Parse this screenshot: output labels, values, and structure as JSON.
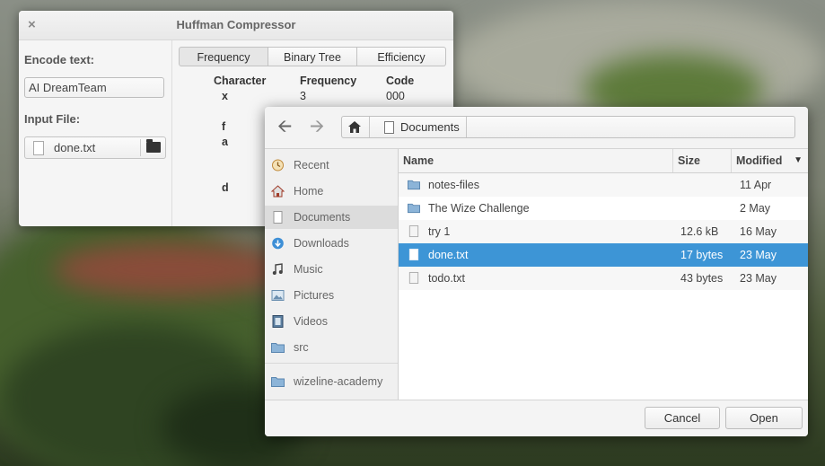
{
  "app": {
    "title": "Huffman Compressor",
    "close_glyph": "×",
    "encode_label": "Encode text:",
    "encode_value": "AI DreamTeam",
    "input_file_label": "Input File:",
    "input_file_name": "done.txt",
    "tabs": [
      "Frequency",
      "Binary Tree",
      "Efficiency"
    ],
    "table": {
      "headers": [
        "Character",
        "Frequency",
        "Code"
      ],
      "visible_cells": {
        "r1": {
          "char": "x",
          "freq": "3",
          "code": "000"
        },
        "r2": {
          "char": "f"
        },
        "r3": {
          "char": "a"
        },
        "r4": {
          "char": "d"
        }
      }
    }
  },
  "dialog": {
    "breadcrumb": "Documents",
    "sidebar": [
      {
        "label": "Recent",
        "icon": "recent-icon"
      },
      {
        "label": "Home",
        "icon": "home-icon"
      },
      {
        "label": "Documents",
        "icon": "document-icon"
      },
      {
        "label": "Downloads",
        "icon": "download-icon"
      },
      {
        "label": "Music",
        "icon": "music-icon"
      },
      {
        "label": "Pictures",
        "icon": "pictures-icon"
      },
      {
        "label": "Videos",
        "icon": "videos-icon"
      },
      {
        "label": "src",
        "icon": "folder-icon"
      },
      {
        "label": "wizeline-academy",
        "icon": "folder-icon"
      }
    ],
    "columns": {
      "name": "Name",
      "size": "Size",
      "modified": "Modified"
    },
    "files": [
      {
        "name": "notes-files",
        "size": "",
        "modified": "11 Apr",
        "icon": "folder-icon"
      },
      {
        "name": "The Wize Challenge",
        "size": "",
        "modified": "2 May",
        "icon": "folder-icon"
      },
      {
        "name": "try 1",
        "size": "12.6 kB",
        "modified": "16 May",
        "icon": "file-icon"
      },
      {
        "name": "done.txt",
        "size": "17 bytes",
        "modified": "23 May",
        "icon": "file-icon"
      },
      {
        "name": "todo.txt",
        "size": "43 bytes",
        "modified": "23 May",
        "icon": "file-icon"
      }
    ],
    "cancel_label": "Cancel",
    "open_label": "Open"
  },
  "colors": {
    "selection": "#3d95d6",
    "folder": "#6a9fd0"
  }
}
